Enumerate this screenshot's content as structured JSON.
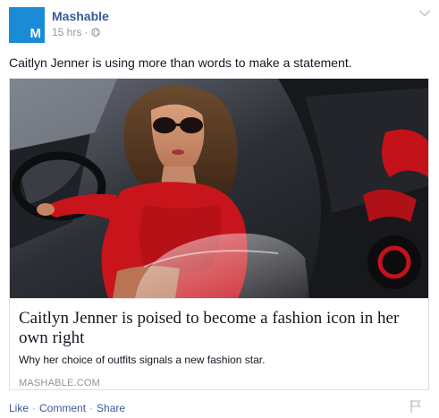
{
  "post": {
    "page_name": "Mashable",
    "avatar_letter": "M",
    "timestamp": "15 hrs",
    "separator": "·",
    "message": "Caitlyn Jenner is using more than words to make a statement.",
    "privacy_icon": "globe-icon",
    "menu_icon": "chevron-down-icon"
  },
  "link_preview": {
    "image_description_icon": "photo",
    "title": "Caitlyn Jenner is poised to become a fashion icon in her own right",
    "description": "Why her choice of outfits signals a new fashion star.",
    "domain": "MASHABLE.COM"
  },
  "actions": {
    "like": "Like",
    "comment": "Comment",
    "share": "Share",
    "separator": "·",
    "flag_icon": "flag-icon"
  },
  "colors": {
    "brand_blue": "#3b5998",
    "mashable_blue": "#1b8bd8",
    "meta_gray": "#9197a3",
    "dress_red": "#c8141b"
  }
}
